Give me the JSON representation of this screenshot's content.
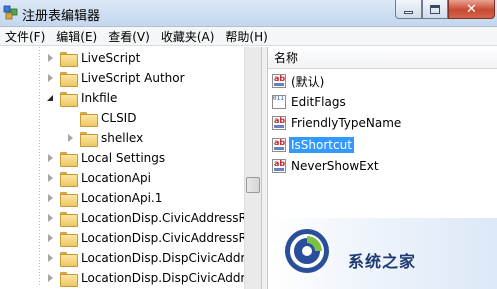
{
  "window": {
    "title": "注册表编辑器",
    "controls": {
      "minimize_icon": "minimize-icon",
      "maximize_icon": "maximize-icon",
      "close_glyph": "✕"
    }
  },
  "menu": [
    {
      "label": "文件(F)"
    },
    {
      "label": "编辑(E)"
    },
    {
      "label": "查看(V)"
    },
    {
      "label": "收藏夹(A)"
    },
    {
      "label": "帮助(H)"
    }
  ],
  "tree": {
    "items": [
      {
        "label": "LiveScript",
        "expander": "collapsed"
      },
      {
        "label": "LiveScript Author",
        "expander": "collapsed"
      },
      {
        "label": "Inkfile",
        "expander": "expanded"
      },
      {
        "label": "CLSID",
        "expander": "none"
      },
      {
        "label": "shellex",
        "expander": "collapsed"
      },
      {
        "label": "Local Settings",
        "expander": "collapsed"
      },
      {
        "label": "LocationApi",
        "expander": "collapsed"
      },
      {
        "label": "LocationApi.1",
        "expander": "collapsed"
      },
      {
        "label": "LocationDisp.CivicAddressRe",
        "expander": "collapsed"
      },
      {
        "label": "LocationDisp.CivicAddressRe",
        "expander": "collapsed"
      },
      {
        "label": "LocationDisp.DispCivicAddre",
        "expander": "collapsed"
      },
      {
        "label": "LocationDisp.DispCivicAddre",
        "expander": "collapsed"
      }
    ]
  },
  "values": {
    "column_header": "名称",
    "items": [
      {
        "label": "(默认)",
        "icon": "string-value-icon",
        "icon_text": "ab"
      },
      {
        "label": "EditFlags",
        "icon": "binary-value-icon",
        "icon_text": "011\n110"
      },
      {
        "label": "FriendlyTypeName",
        "icon": "string-value-icon",
        "icon_text": "ab"
      },
      {
        "label": "IsShortcut",
        "icon": "string-value-icon",
        "icon_text": "ab",
        "selected": true
      },
      {
        "label": "NeverShowExt",
        "icon": "string-value-icon",
        "icon_text": "ab"
      }
    ]
  },
  "watermark": {
    "text": "系统之家"
  },
  "colors": {
    "selection": "#3399ff",
    "titlebar": "#c4d7ee",
    "folder": "#eec763"
  }
}
